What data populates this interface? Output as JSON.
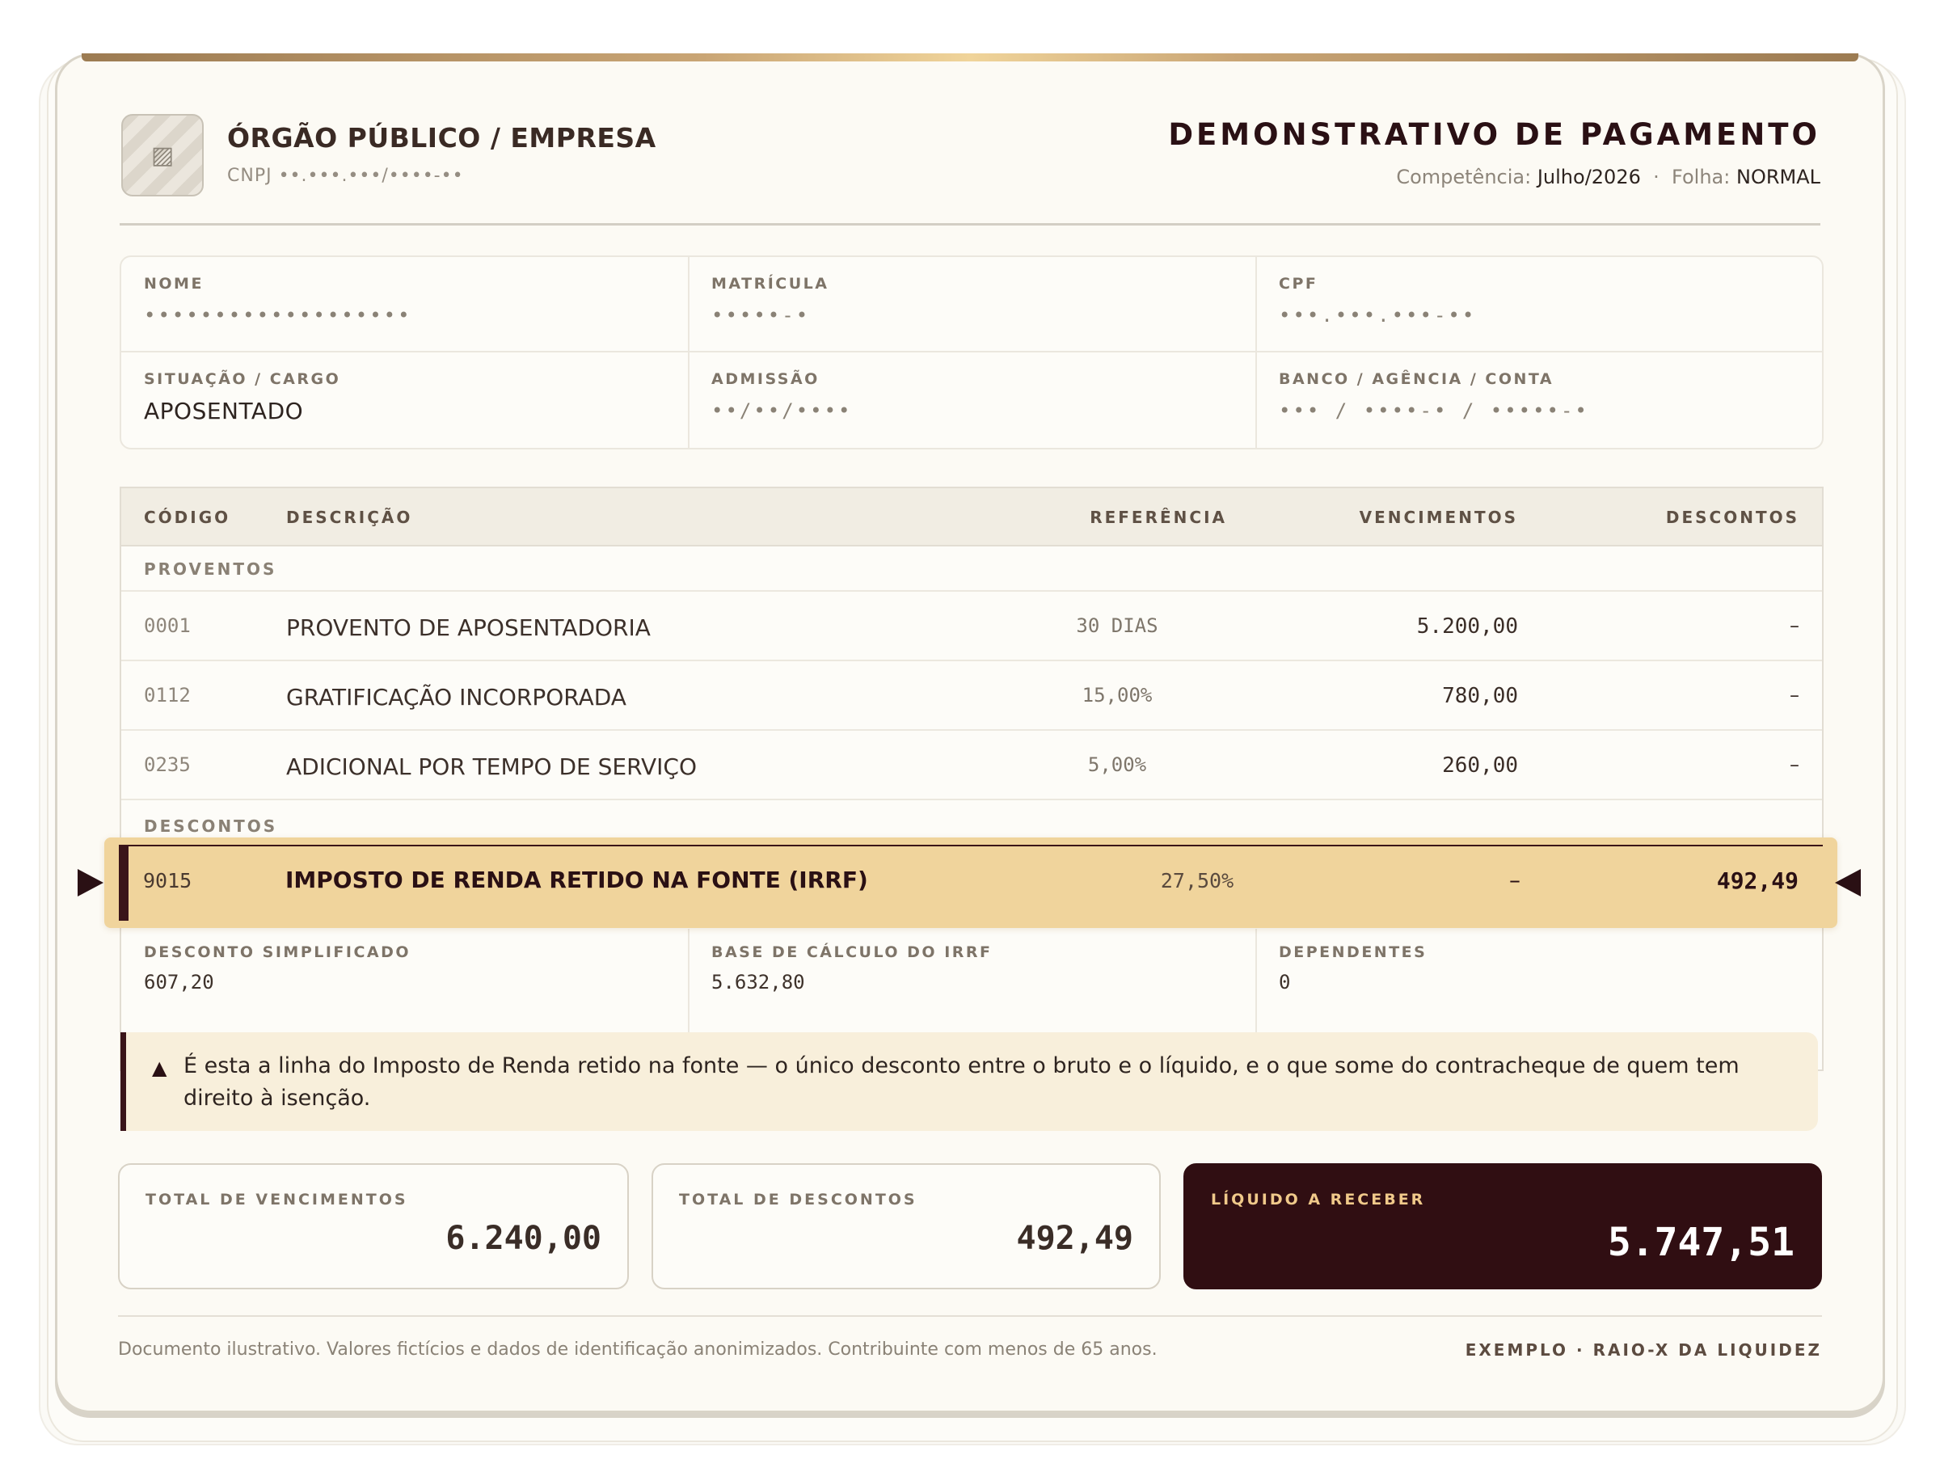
{
  "header": {
    "logo_icon": "image-placeholder-icon",
    "org_name": "ÓRGÃO PÚBLICO / EMPRESA",
    "cnpj": "CNPJ ••.•••.•••/••••-••",
    "doc_title": "DEMONSTRATIVO DE PAGAMENTO",
    "competencia_label": "Competência:",
    "competencia_value": "Julho/2026",
    "separator": "·",
    "folha_label": "Folha:",
    "folha_value": "NORMAL"
  },
  "identification": {
    "nome_label": "NOME",
    "nome_value": "•••••••••••••••••••",
    "matricula_label": "MATRÍCULA",
    "matricula_value": "•••••-•",
    "cpf_label": "CPF",
    "cpf_value": "•••.•••.•••-••",
    "situacao_label": "SITUAÇÃO / CARGO",
    "situacao_value": "APOSENTADO",
    "admissao_label": "ADMISSÃO",
    "admissao_value": "••/••/••••",
    "banco_label": "BANCO / AGÊNCIA / CONTA",
    "banco_value": "••• / ••••-• / •••••-•"
  },
  "table": {
    "headers": {
      "codigo": "CÓDIGO",
      "descricao": "DESCRIÇÃO",
      "referencia": "REFERÊNCIA",
      "vencimentos": "VENCIMENTOS",
      "descontos": "DESCONTOS"
    },
    "proventos_section": "PROVENTOS",
    "proventos": [
      {
        "code": "0001",
        "desc": "PROVENTO DE APOSENTADORIA",
        "ref": "30 DIAS",
        "venc": "5.200,00",
        "descontos": "–"
      },
      {
        "code": "0112",
        "desc": "GRATIFICAÇÃO INCORPORADA",
        "ref": "15,00%",
        "venc": "780,00",
        "descontos": "–"
      },
      {
        "code": "0235",
        "desc": "ADICIONAL POR TEMPO DE SERVIÇO",
        "ref": "5,00%",
        "venc": "260,00",
        "descontos": "–"
      }
    ],
    "descontos_section": "DESCONTOS",
    "highlight": {
      "code": "9015",
      "desc": "IMPOSTO DE RENDA RETIDO NA FONTE (IRRF)",
      "ref": "27,50%",
      "venc": "–",
      "descontos": "492,49"
    },
    "details": [
      {
        "label": "DESCONTO SIMPLIFICADO",
        "value": "607,20"
      },
      {
        "label": "BASE DE CÁLCULO DO IRRF",
        "value": "5.632,80"
      },
      {
        "label": "DEPENDENTES",
        "value": "0"
      }
    ]
  },
  "note": {
    "icon": "warning-triangle-icon",
    "text": "É esta a linha do Imposto de Renda retido na fonte — o único desconto entre o bruto e o líquido, e o que some do contracheque de quem tem direito à isenção."
  },
  "totals": {
    "vencimentos_label": "TOTAL DE VENCIMENTOS",
    "vencimentos_value": "6.240,00",
    "descontos_label": "TOTAL DE DESCONTOS",
    "descontos_value": "492,49",
    "liquido_label": "LÍQUIDO A RECEBER",
    "liquido_value": "5.747,51"
  },
  "footer": {
    "disclaimer": "Documento ilustrativo. Valores fictícios e dados de identificação anonimizados. Contribuinte com menos de 65 anos.",
    "tag": "EXEMPLO · RAIO-X DA LIQUIDEZ"
  },
  "colors": {
    "highlight": "#f0d49c",
    "dark_accent": "#300e12",
    "gold": "#c9a575"
  }
}
